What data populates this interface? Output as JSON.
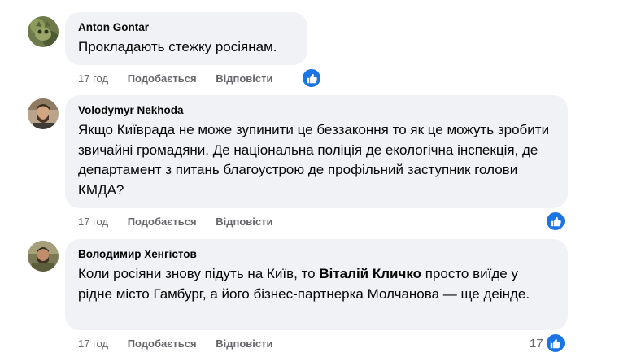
{
  "comments": [
    {
      "author": "Anton Gontar",
      "text": "Прокладають стежку росіянам.",
      "time": "17 год",
      "like_label": "Подобається",
      "reply_label": "Відповісти",
      "reaction_icon": "thumbs-up-icon",
      "reaction_count": ""
    },
    {
      "author": "Volodymyr Nekhoda",
      "text": "Якщо Київрада не може зупинити це беззаконня то як це можуть зробити звичайні громадяни. Де національна поліція де екологічна інспекція, де департамент з питань благоустрою де профільний заступник голови КМДА?",
      "time": "17 год",
      "like_label": "Подобається",
      "reply_label": "Відповісти",
      "reaction_icon": "thumbs-up-icon",
      "reaction_count": ""
    },
    {
      "author": "Володимир Хенгістов",
      "text_before": "Коли росіяни знову підуть на Київ, то ",
      "mention": "Віталій Кличко",
      "text_after": " просто виїде у рідне місто Гамбург, а його бізнес-партнерка Молчанова — ще деінде.",
      "time": "17 год",
      "like_label": "Подобається",
      "reply_label": "Відповісти",
      "reaction_icon": "thumbs-up-icon",
      "reaction_count": "17"
    }
  ],
  "colors": {
    "bubble": "#f0f2f5",
    "secondary_text": "#65676b",
    "like_blue": "#1b74e4"
  }
}
